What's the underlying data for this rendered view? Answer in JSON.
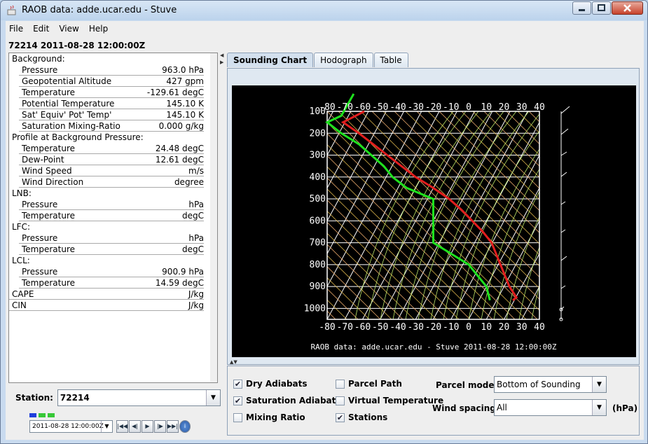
{
  "window": {
    "title": "RAOB data: adde.ucar.edu - Stuve"
  },
  "menu": [
    "File",
    "Edit",
    "View",
    "Help"
  ],
  "station_title": "72214 2011-08-28 12:00:00Z",
  "left_panel": {
    "sections": [
      {
        "header": "Background:",
        "rows": [
          {
            "label": "Pressure",
            "value": "963.0 hPa"
          },
          {
            "label": "Geopotential Altitude",
            "value": "427 gpm"
          },
          {
            "label": "Temperature",
            "value": "-129.61 degC"
          },
          {
            "label": "Potential Temperature",
            "value": "145.10 K"
          },
          {
            "label": "Sat' Equiv' Pot' Temp'",
            "value": "145.10 K"
          },
          {
            "label": "Saturation Mixing-Ratio",
            "value": "0.000 g/kg"
          }
        ]
      },
      {
        "header": "Profile at Background Pressure:",
        "rows": [
          {
            "label": "Temperature",
            "value": "24.48 degC"
          },
          {
            "label": "Dew-Point",
            "value": "12.61 degC"
          },
          {
            "label": "Wind Speed",
            "value": "m/s"
          },
          {
            "label": "Wind Direction",
            "value": "degree"
          }
        ]
      },
      {
        "header": "LNB:",
        "rows": [
          {
            "label": "Pressure",
            "value": "hPa"
          },
          {
            "label": "Temperature",
            "value": "degC"
          }
        ]
      },
      {
        "header": "LFC:",
        "rows": [
          {
            "label": "Pressure",
            "value": "hPa"
          },
          {
            "label": "Temperature",
            "value": "degC"
          }
        ]
      },
      {
        "header": "LCL:",
        "rows": [
          {
            "label": "Pressure",
            "value": "900.9 hPa"
          },
          {
            "label": "Temperature",
            "value": "14.59 degC"
          }
        ]
      }
    ],
    "cape": {
      "label": "CAPE",
      "value": "J/kg"
    },
    "cin": {
      "label": "CIN",
      "value": "J/kg"
    }
  },
  "station": {
    "label": "Station:",
    "value": "72214"
  },
  "time": {
    "value": "2011-08-28 12:00:00Z"
  },
  "time_blocks": [
    "#1f3fdc",
    "#37c837",
    "#37c837"
  ],
  "anim_icons": [
    "first-frame-icon",
    "step-back-icon",
    "play-icon",
    "step-forward-icon",
    "last-frame-icon",
    "info-icon"
  ],
  "tabs": [
    "Sounding Chart",
    "Hodograph",
    "Table"
  ],
  "chart_data": {
    "type": "line",
    "caption": "RAOB data: adde.ucar.edu - Stuve 2011-08-28 12:00:00Z",
    "x_ticks": [
      "-80",
      "-70",
      "-60",
      "-50",
      "-40",
      "-30",
      "-20",
      "-10",
      "0",
      "10",
      "20",
      "30",
      "40"
    ],
    "y_ticks": [
      "100",
      "200",
      "300",
      "400",
      "500",
      "600",
      "700",
      "800",
      "900",
      "1000"
    ],
    "xlim": [
      -80,
      40
    ],
    "ylim": [
      100,
      1050
    ],
    "series": [
      {
        "color": "#e11e1e",
        "points": [
          [
            -59,
            100
          ],
          [
            -71,
            150
          ],
          [
            -62,
            200
          ],
          [
            -54,
            250
          ],
          [
            -46,
            300
          ],
          [
            -38,
            350
          ],
          [
            -30,
            400
          ],
          [
            -20,
            450
          ],
          [
            -11,
            500
          ],
          [
            -4,
            550
          ],
          [
            2,
            600
          ],
          [
            8,
            650
          ],
          [
            13,
            700
          ],
          [
            18,
            800
          ],
          [
            23,
            900
          ],
          [
            27,
            950
          ],
          [
            25,
            963
          ]
        ]
      },
      {
        "color": "#1ee11e",
        "points": [
          [
            -65,
            20
          ],
          [
            -72,
            120
          ],
          [
            -80,
            150
          ],
          [
            -72,
            200
          ],
          [
            -62,
            250
          ],
          [
            -55,
            300
          ],
          [
            -48,
            350
          ],
          [
            -43,
            400
          ],
          [
            -35,
            450
          ],
          [
            -20,
            500
          ],
          [
            -20,
            700
          ],
          [
            0,
            800
          ],
          [
            10,
            900
          ],
          [
            12,
            963
          ]
        ]
      }
    ],
    "grid": "on"
  },
  "controls": {
    "checkboxes": [
      {
        "label": "Dry Adiabats",
        "checked": "✔"
      },
      {
        "label": "Saturation Adiabats",
        "checked": "✔"
      },
      {
        "label": "Mixing Ratio",
        "checked": ""
      },
      {
        "label": "Parcel Path",
        "checked": ""
      },
      {
        "label": "Virtual Temperature",
        "checked": ""
      },
      {
        "label": "Stations",
        "checked": "✔"
      }
    ],
    "parcel_mode": {
      "label": "Parcel mode:",
      "value": "Bottom of Sounding"
    },
    "wind_spacing": {
      "label": "Wind spacing:",
      "value": "All",
      "unit": "(hPa)"
    }
  }
}
